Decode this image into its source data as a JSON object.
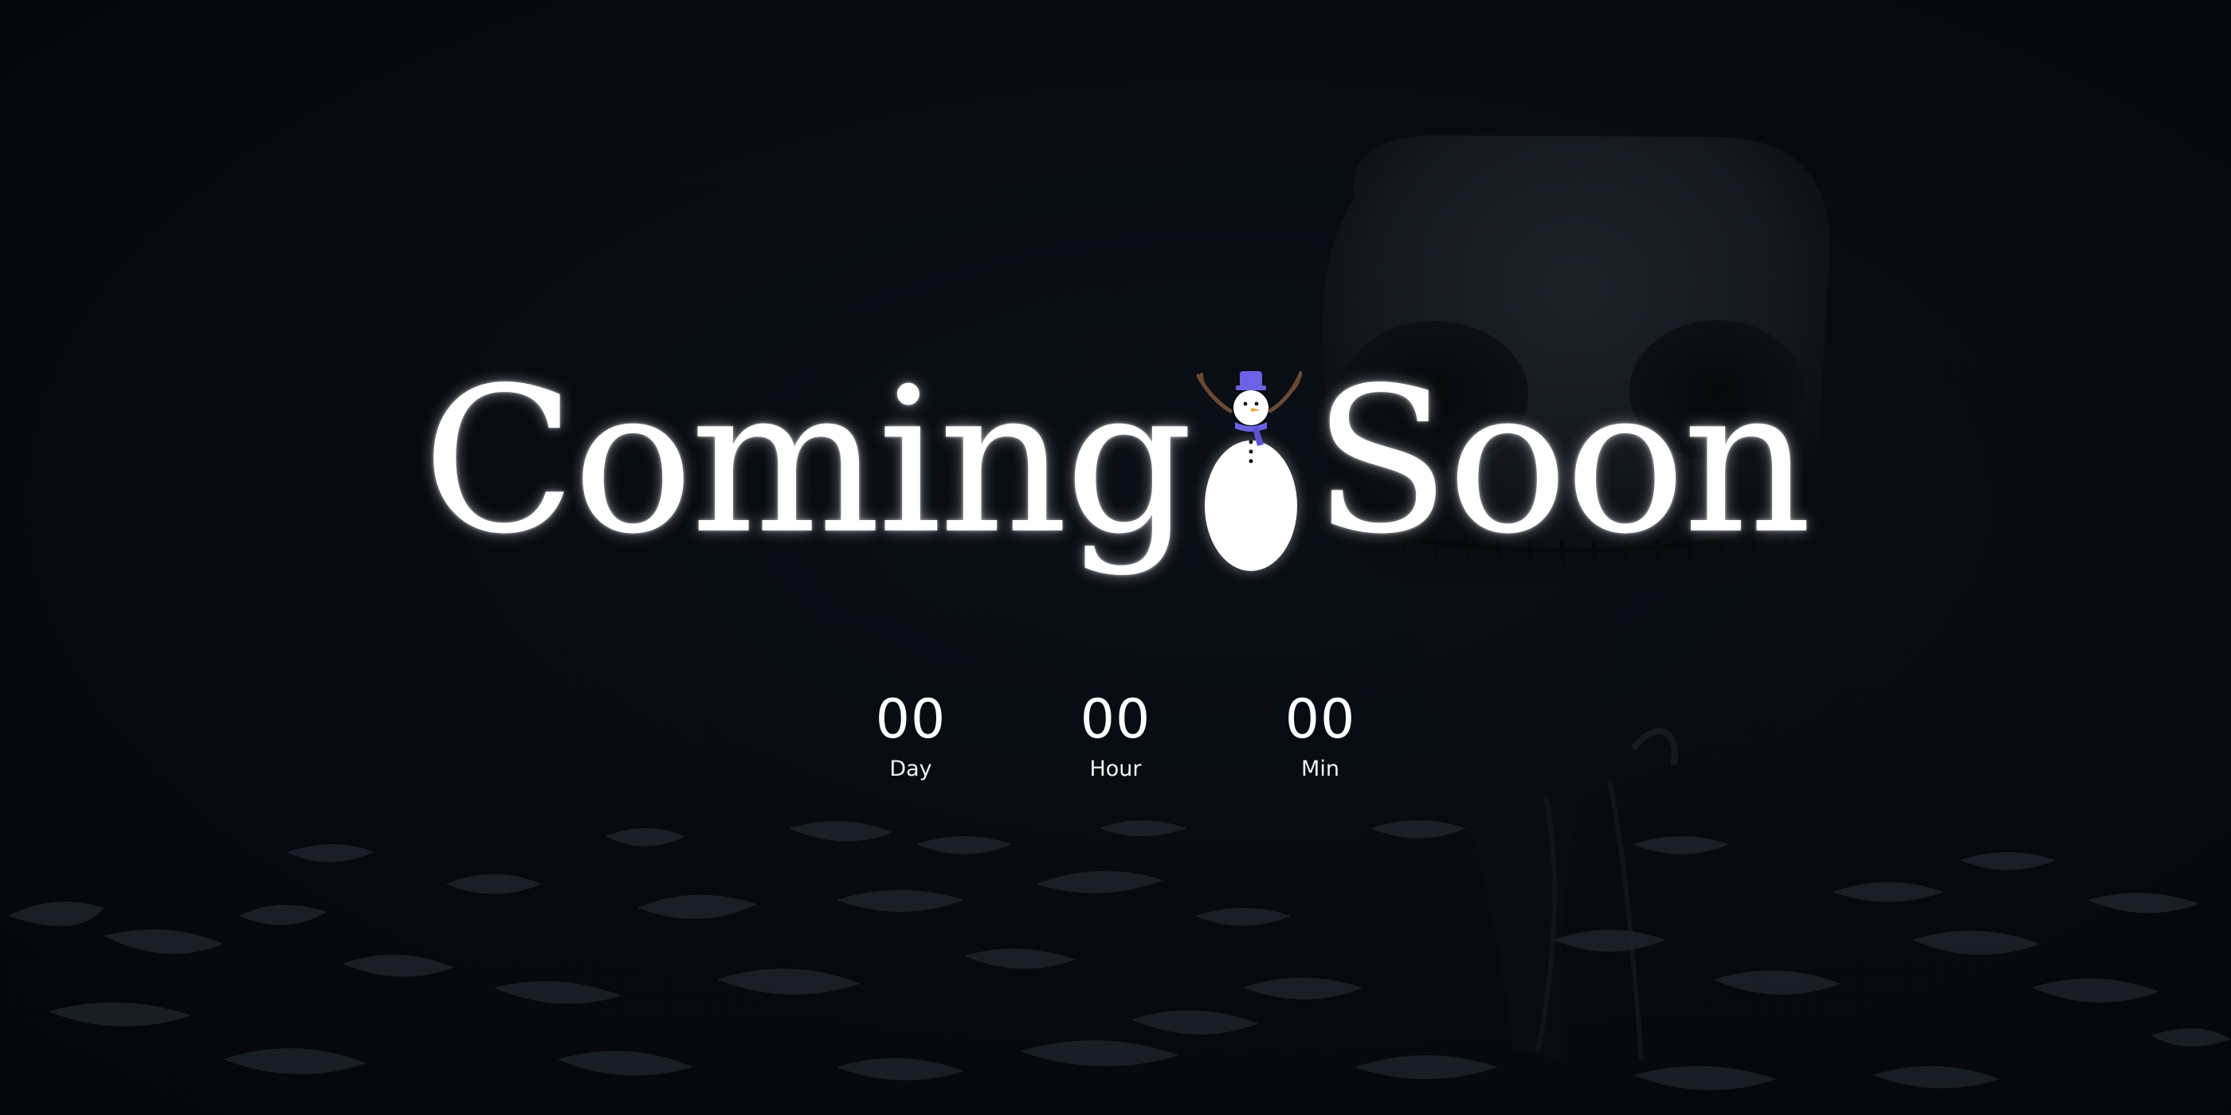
{
  "headline": {
    "word_left": "Coming",
    "word_right": "Soon"
  },
  "countdown": [
    {
      "value": "00",
      "label": "Day"
    },
    {
      "value": "00",
      "label": "Hour"
    },
    {
      "value": "00",
      "label": "Min"
    }
  ],
  "icons": [
    "snowman-icon"
  ],
  "colors": {
    "background": "#05080e",
    "text": "#ffffff",
    "snowman_hat": "#6b63e6",
    "snowman_scarf": "#6b63e6",
    "snowman_nose": "#f0a040",
    "snowman_arms": "#6b4a32"
  }
}
